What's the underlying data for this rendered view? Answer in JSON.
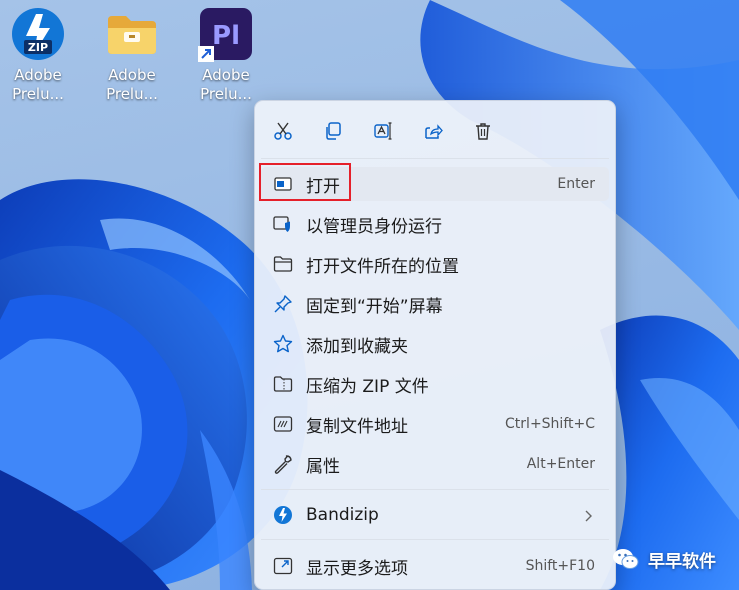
{
  "desktop": {
    "icons": [
      {
        "label_line1": "Adobe",
        "label_line2": "Prelu...",
        "badge": "ZIP",
        "icon": "bandizip-zip-icon"
      },
      {
        "label_line1": "Adobe",
        "label_line2": "Prelu...",
        "icon": "folder-icon"
      },
      {
        "label_line1": "Adobe",
        "label_line2": "Prelu...",
        "logo": "Pl",
        "icon": "premiere-pl-icon"
      }
    ]
  },
  "context_menu": {
    "toolbar": [
      {
        "icon": "cut-icon",
        "action": "cut"
      },
      {
        "icon": "copy-icon",
        "action": "copy"
      },
      {
        "icon": "rename-icon",
        "action": "rename"
      },
      {
        "icon": "share-icon",
        "action": "share"
      },
      {
        "icon": "delete-icon",
        "action": "delete"
      }
    ],
    "items": [
      {
        "label": "打开",
        "shortcut": "Enter",
        "icon": "open-app-icon"
      },
      {
        "label": "以管理员身份运行",
        "shortcut": "",
        "icon": "run-as-admin-icon"
      },
      {
        "label": "打开文件所在的位置",
        "shortcut": "",
        "icon": "folder-icon"
      },
      {
        "label": "固定到“开始”屏幕",
        "shortcut": "",
        "icon": "pin-icon"
      },
      {
        "label": "添加到收藏夹",
        "shortcut": "",
        "icon": "star-icon"
      },
      {
        "label": "压缩为 ZIP 文件",
        "shortcut": "",
        "icon": "zip-folder-icon"
      },
      {
        "label": "复制文件地址",
        "shortcut": "Ctrl+Shift+C",
        "icon": "copy-path-icon"
      },
      {
        "label": "属性",
        "shortcut": "Alt+Enter",
        "icon": "wrench-icon"
      },
      {
        "label": "Bandizip",
        "shortcut": "",
        "icon": "bandizip-icon",
        "submenu": true
      },
      {
        "label": "显示更多选项",
        "shortcut": "Shift+F10",
        "icon": "more-options-icon"
      }
    ]
  },
  "watermark": {
    "text": "早早软件",
    "icon": "wechat-icon"
  },
  "colors": {
    "accent": "#0a63c9",
    "highlight_border": "#e5202a",
    "menu_bg": "#eef2fa",
    "premiere_bg": "#2a1a62",
    "premiere_text": "#9a9aff"
  }
}
